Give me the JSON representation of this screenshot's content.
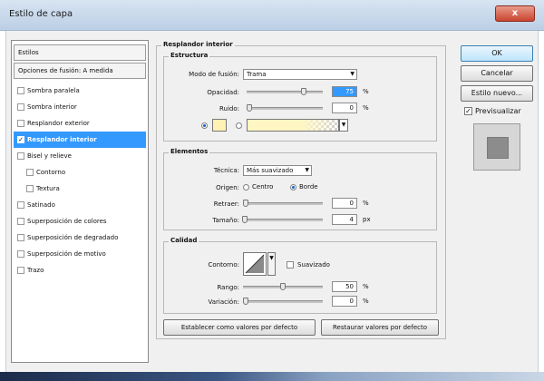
{
  "window": {
    "title": "Estilo de capa",
    "close_label": "x"
  },
  "sidebar": {
    "header_styles": "Estilos",
    "header_blend": "Opciones de fusión: A medida",
    "items": [
      {
        "label": "Sombra paralela",
        "checked": false,
        "selected": false,
        "indent": false
      },
      {
        "label": "Sombra interior",
        "checked": false,
        "selected": false,
        "indent": false
      },
      {
        "label": "Resplandor exterior",
        "checked": false,
        "selected": false,
        "indent": false
      },
      {
        "label": "Resplandor interior",
        "checked": true,
        "selected": true,
        "indent": false
      },
      {
        "label": "Bisel y relieve",
        "checked": false,
        "selected": false,
        "indent": false
      },
      {
        "label": "Contorno",
        "checked": false,
        "selected": false,
        "indent": true
      },
      {
        "label": "Textura",
        "checked": false,
        "selected": false,
        "indent": true
      },
      {
        "label": "Satinado",
        "checked": false,
        "selected": false,
        "indent": false
      },
      {
        "label": "Superposición de colores",
        "checked": false,
        "selected": false,
        "indent": false
      },
      {
        "label": "Superposición de degradado",
        "checked": false,
        "selected": false,
        "indent": false
      },
      {
        "label": "Superposición de motivo",
        "checked": false,
        "selected": false,
        "indent": false
      },
      {
        "label": "Trazo",
        "checked": false,
        "selected": false,
        "indent": false
      }
    ]
  },
  "panel": {
    "title": "Resplandor interior",
    "estructura": {
      "title": "Estructura",
      "blend_mode_label": "Modo de fusión:",
      "blend_mode_value": "Trama",
      "opacity_label": "Opacidad:",
      "opacity_value": "75",
      "opacity_unit": "%",
      "noise_label": "Ruido:",
      "noise_value": "0",
      "noise_unit": "%",
      "color_swatch": "#fff2b3",
      "gradient_swatch": "#fff6c4"
    },
    "elementos": {
      "title": "Elementos",
      "technique_label": "Técnica:",
      "technique_value": "Más suavizado",
      "source_label": "Origen:",
      "source_center": "Centro",
      "source_edge": "Borde",
      "choke_label": "Retraer:",
      "choke_value": "0",
      "choke_unit": "%",
      "size_label": "Tamaño:",
      "size_value": "4",
      "size_unit": "px"
    },
    "calidad": {
      "title": "Calidad",
      "contour_label": "Contorno:",
      "antialias_label": "Suavizado",
      "range_label": "Rango:",
      "range_value": "50",
      "range_unit": "%",
      "jitter_label": "Variación:",
      "jitter_value": "0",
      "jitter_unit": "%"
    },
    "make_default": "Establecer como valores por defecto",
    "reset_default": "Restaurar valores por defecto"
  },
  "actions": {
    "ok": "OK",
    "cancel": "Cancelar",
    "new_style": "Estilo nuevo...",
    "preview_label": "Previsualizar"
  },
  "slider_levels": {
    "opacity": 0.75,
    "noise": 0.0,
    "choke": 0.0,
    "size": 0.02,
    "range": 0.5,
    "jitter": 0.0
  }
}
